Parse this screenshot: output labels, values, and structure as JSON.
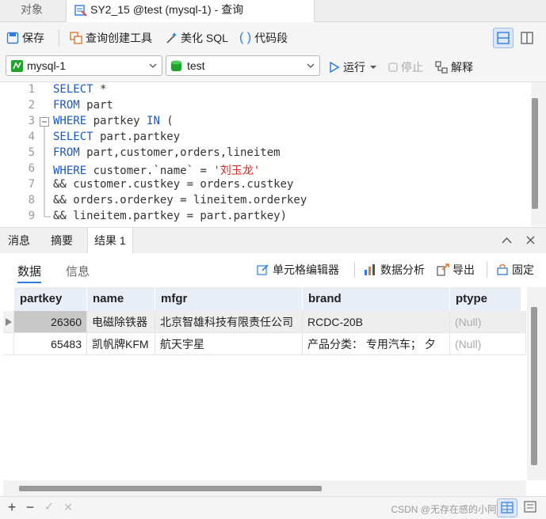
{
  "tabs": {
    "objects": "对象",
    "query": "SY2_15 @test (mysql-1) - 查询"
  },
  "toolbar": {
    "save": "保存",
    "query_builder": "查询创建工具",
    "beautify": "美化 SQL",
    "snippet": "代码段"
  },
  "selectors": {
    "connection": "mysql-1",
    "database": "test",
    "run": "运行",
    "stop": "停止",
    "explain": "解释"
  },
  "editor": {
    "line_numbers": [
      "1",
      "2",
      "3",
      "4",
      "5",
      "6",
      "7",
      "8",
      "9"
    ],
    "lines": [
      "SELECT *",
      "FROM part",
      "WHERE partkey IN (",
      "SELECT part.partkey",
      "FROM part,customer,orders,lineitem",
      "WHERE customer.`name` = '刘玉龙'",
      "&& customer.custkey = orders.custkey",
      "&& orders.orderkey = lineitem.orderkey",
      "&& lineitem.partkey = part.partkey)"
    ]
  },
  "result_tabs": {
    "messages": "消息",
    "summary": "摘要",
    "result1": "结果 1"
  },
  "subtabs": {
    "data": "数据",
    "info": "信息"
  },
  "result_tools": {
    "cell_editor": "单元格编辑器",
    "data_analysis": "数据分析",
    "export": "导出",
    "pin": "固定"
  },
  "grid": {
    "columns": [
      "partkey",
      "name",
      "mfgr",
      "brand",
      "ptype"
    ],
    "rows": [
      [
        "26360",
        "电磁除铁器",
        "北京智雄科技有限责任公司",
        "RCDC-20B",
        "(Null)"
      ],
      [
        "65483",
        "凯帆牌KFM",
        "航天宇星",
        "产品分类：  专用汽车；  夕",
        "(Null)"
      ]
    ]
  },
  "bottom": {
    "add": "+",
    "remove": "−",
    "apply": "✓",
    "discard": "✕",
    "watermark": "CSDN @无存在感的小阿柯"
  },
  "colors": {
    "keyword": "#1a56c4",
    "string": "#d9261c",
    "accent": "#2f7be0",
    "selected_cell": "#c8c8c8"
  }
}
